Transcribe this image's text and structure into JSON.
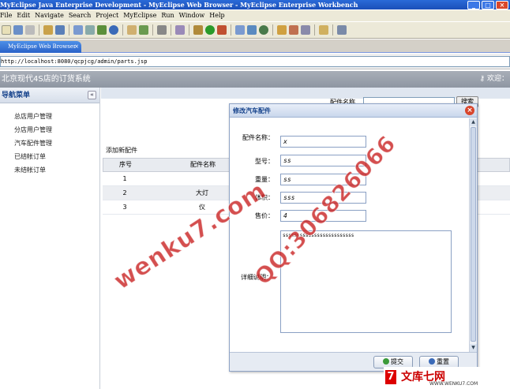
{
  "window": {
    "title": "MyEclipse Java Enterprise Development - MyEclipse Web Browser - MyEclipse Enterprise Workbench"
  },
  "menu": [
    "File",
    "Edit",
    "Navigate",
    "Search",
    "Project",
    "MyEclipse",
    "Run",
    "Window",
    "Help"
  ],
  "browser": {
    "tab_label": "MyEclipse Web Browser",
    "url": "http://localhost:8080/qcpjcg/admin/parts.jsp"
  },
  "app": {
    "title": "北京现代4S店的订货系统",
    "welcome": "欢迎："
  },
  "nav": {
    "header": "导航菜单",
    "items": [
      "总店用户管理",
      "分店用户管理",
      "汽车配件管理",
      "已结帐订单",
      "未结帐订单"
    ]
  },
  "main": {
    "search_label": "配件名称",
    "search_button": "搜索",
    "add_link": "添加新配件",
    "columns": [
      "序号",
      "配件名称"
    ],
    "rows": [
      {
        "no": "1",
        "name": ""
      },
      {
        "no": "2",
        "name": "大灯"
      },
      {
        "no": "3",
        "name": "仪"
      }
    ]
  },
  "dialog": {
    "title": "修改汽车配件",
    "fields": {
      "name_label": "配件名称：",
      "name_value": "x",
      "model_label": "型号：",
      "model_value": "ss",
      "weight_label": "重量：",
      "weight_value": "ss",
      "volume_label": "体积：",
      "volume_value": "sss",
      "price_label": "售价：",
      "price_value": "4",
      "desc_label": "详细说明：",
      "desc_value": "sssssssssssssssssssssssss"
    },
    "submit_button": "提交",
    "reset_button": "重置"
  },
  "watermark": {
    "site": "wenku7.com",
    "qq": "QQ:306826066",
    "brand_name": "文库七网",
    "brand_url": "WWW.WENKU7.COM"
  }
}
